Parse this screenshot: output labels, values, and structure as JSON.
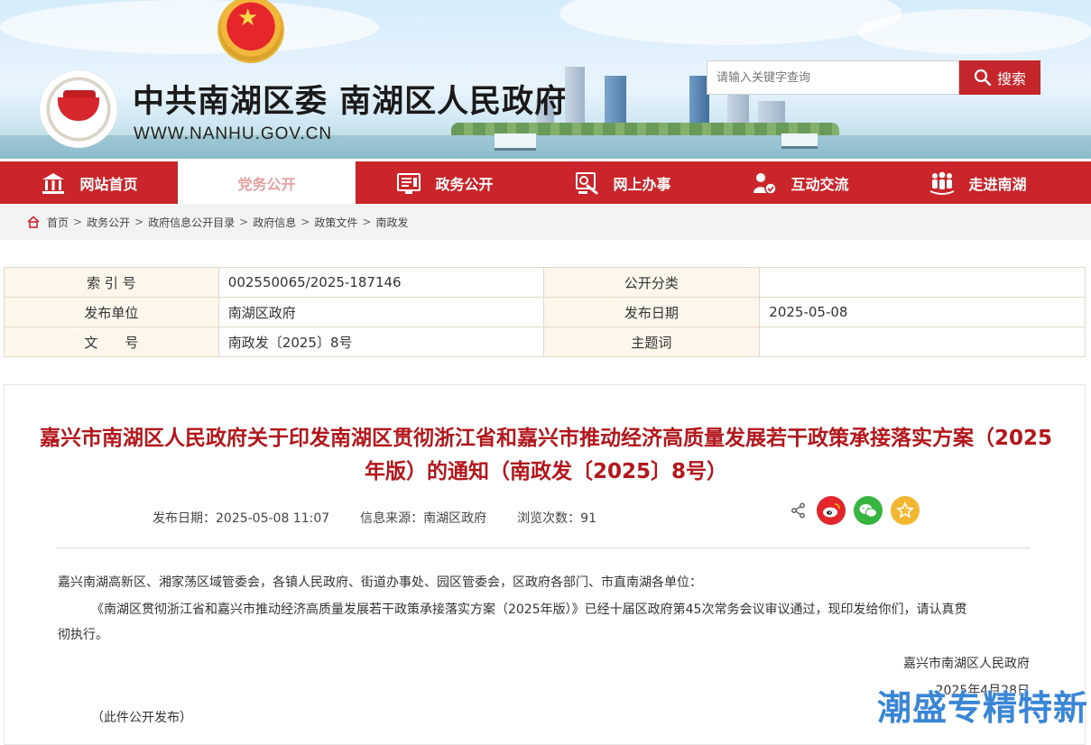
{
  "header": {
    "site_title": "中共南湖区委 南湖区人民政府",
    "site_url": "WWW.NANHU.GOV.CN",
    "search": {
      "placeholder": "请输入关键字查询",
      "button_label": "搜索"
    }
  },
  "nav": {
    "items": [
      {
        "label": "网站首页",
        "icon": "home-building-icon"
      },
      {
        "label": "党务公开",
        "icon": "none",
        "active": true
      },
      {
        "label": "政务公开",
        "icon": "document-icon"
      },
      {
        "label": "网上办事",
        "icon": "online-service-icon"
      },
      {
        "label": "互动交流",
        "icon": "interaction-icon"
      },
      {
        "label": "走进南湖",
        "icon": "people-icon"
      }
    ],
    "accent_color": "#c9252a"
  },
  "breadcrumb": [
    "首页",
    "政务公开",
    "政府信息公开目录",
    "政府信息",
    "政策文件",
    "南政发"
  ],
  "meta": {
    "index_no_label": "索 引 号",
    "index_no": "002550065/2025-187146",
    "category_label": "公开分类",
    "category": "",
    "publisher_label": "发布单位",
    "publisher": "南湖区政府",
    "pub_date_label": "发布日期",
    "pub_date": "2025-05-08",
    "doc_no_label": "文　　号",
    "doc_no": "南政发〔2025〕8号",
    "subject_label": "主题词",
    "subject": ""
  },
  "article": {
    "title": "嘉兴市南湖区人民政府关于印发南湖区贯彻浙江省和嘉兴市推动经济高质量发展若干政策承接落实方案（2025年版）的通知（南政发〔2025〕8号）",
    "info_date": "发布日期：2025-05-08 11:07",
    "info_source": "信息来源：南湖区政府",
    "info_views": "浏览次数：91",
    "recipients": "嘉兴南湖高新区、湘家荡区域管委会，各镇人民政府、街道办事处、园区管委会，区政府各部门、市直南湖各单位：",
    "paragraph_line1": "《南湖区贯彻浙江省和嘉兴市推动经济高质量发展若干政策承接落实方案（2025年版）》已经十届区政府第45次常务会议审议通过，现印发给你们，请认真贯",
    "paragraph_line2": "彻执行。",
    "signature": "嘉兴市南湖区人民政府",
    "sign_date": "2025年4月28日",
    "note": "（此件公开发布）"
  },
  "watermark": "潮盛专精特新"
}
